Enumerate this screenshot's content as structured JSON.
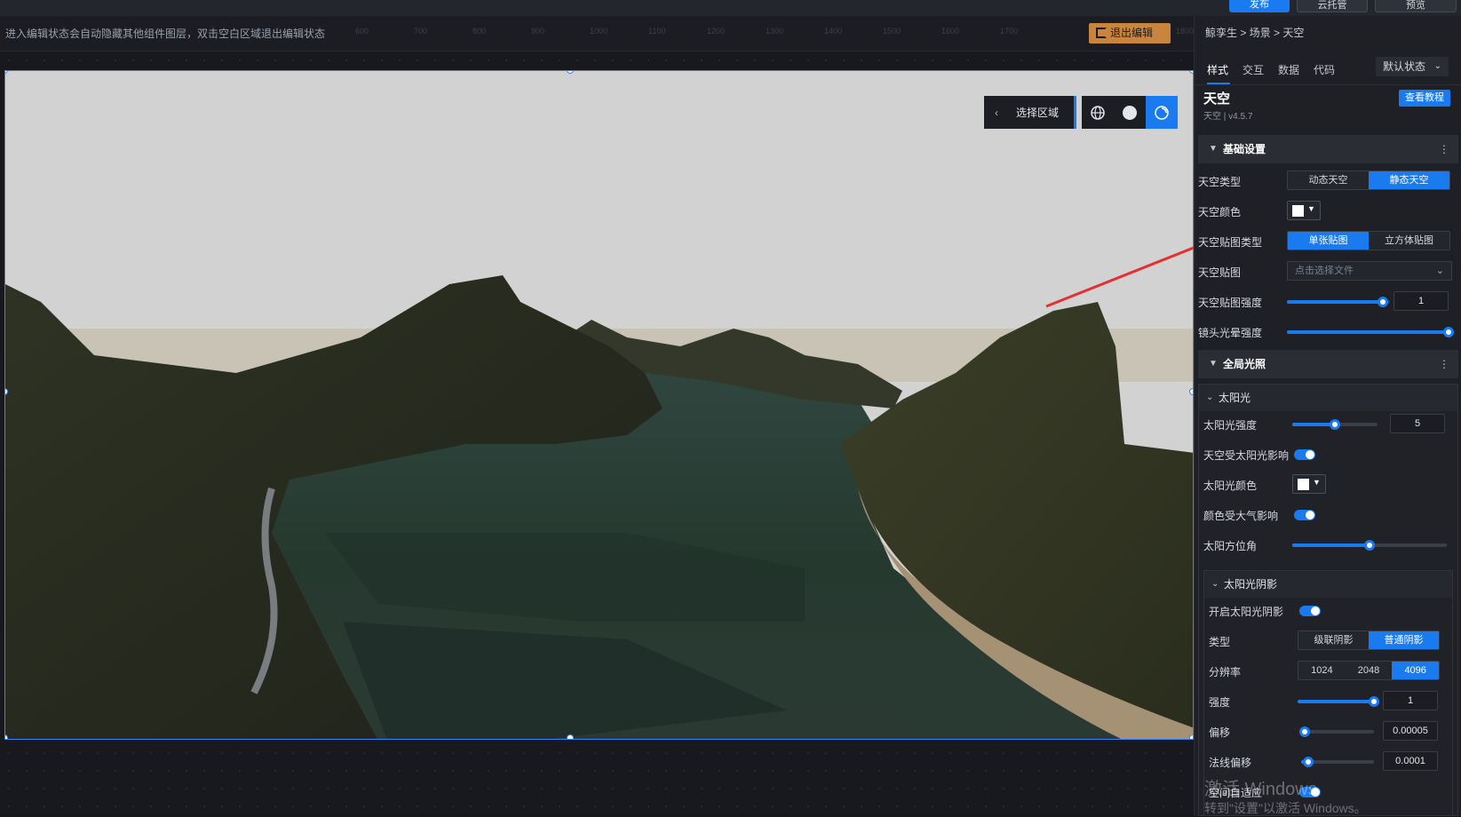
{
  "topbar": {
    "publish": "发布",
    "cloud": "云托管",
    "preview": "预览"
  },
  "editor": {
    "hint": "进入编辑状态会自动隐藏其他组件图层，双击空白区域退出编辑状态",
    "exit_edit": "退出编辑",
    "ruler_ticks": [
      "600",
      "700",
      "800",
      "900",
      "1000",
      "1100",
      "1200",
      "1300",
      "1400",
      "1500",
      "1600",
      "1700",
      "1800"
    ]
  },
  "scene_toolbar": {
    "select_region": "选择区域"
  },
  "panel": {
    "breadcrumb": "鲸孪生 > 场景 > 天空",
    "tabs": [
      "样式",
      "交互",
      "数据",
      "代码"
    ],
    "state_select": "默认状态",
    "component_title": "天空",
    "component_subtitle": "天空 | v4.5.7",
    "tutorial_button": "查看教程",
    "basic": {
      "title": "基础设置",
      "sky_type_label": "天空类型",
      "sky_type_options": [
        "动态天空",
        "静态天空"
      ],
      "sky_color_label": "天空颜色",
      "sky_texture_type_label": "天空贴图类型",
      "sky_texture_type_options": [
        "单张贴图",
        "立方体贴图"
      ],
      "sky_texture_label": "天空贴图",
      "sky_texture_placeholder": "点击选择文件",
      "sky_texture_strength_label": "天空贴图强度",
      "sky_texture_strength_value": "1",
      "sky_texture_strength_level": 0.93,
      "lens_flare_label": "镜头光晕强度",
      "lens_flare_level": 1.0
    },
    "global_light": {
      "title": "全局光照",
      "sun": {
        "title": "太阳光",
        "intensity_label": "太阳光强度",
        "intensity_value": "5",
        "intensity_level": 0.5,
        "sky_affected_label": "天空受太阳光影响",
        "color_label": "太阳光颜色",
        "atmosphere_label": "颜色受大气影响",
        "azimuth_label": "太阳方位角",
        "azimuth_level": 0.5
      },
      "shadow": {
        "title": "太阳光阴影",
        "enable_label": "开启太阳光阴影",
        "type_label": "类型",
        "type_options": [
          "级联阴影",
          "普通阴影"
        ],
        "resolution_label": "分辨率",
        "resolution_options": [
          "1024",
          "2048",
          "4096"
        ],
        "strength_label": "强度",
        "strength_value": "1",
        "strength_level": 1.0,
        "offset_label": "偏移",
        "offset_value": "0.00005",
        "offset_level": 0.05,
        "normal_offset_label": "法线偏移",
        "normal_offset_value": "0.0001",
        "normal_offset_level": 0.1,
        "adaptive_label": "空间自适应"
      }
    }
  },
  "watermark": {
    "line1": "激活 Windows",
    "line2": "转到\"设置\"以激活 Windows。"
  }
}
